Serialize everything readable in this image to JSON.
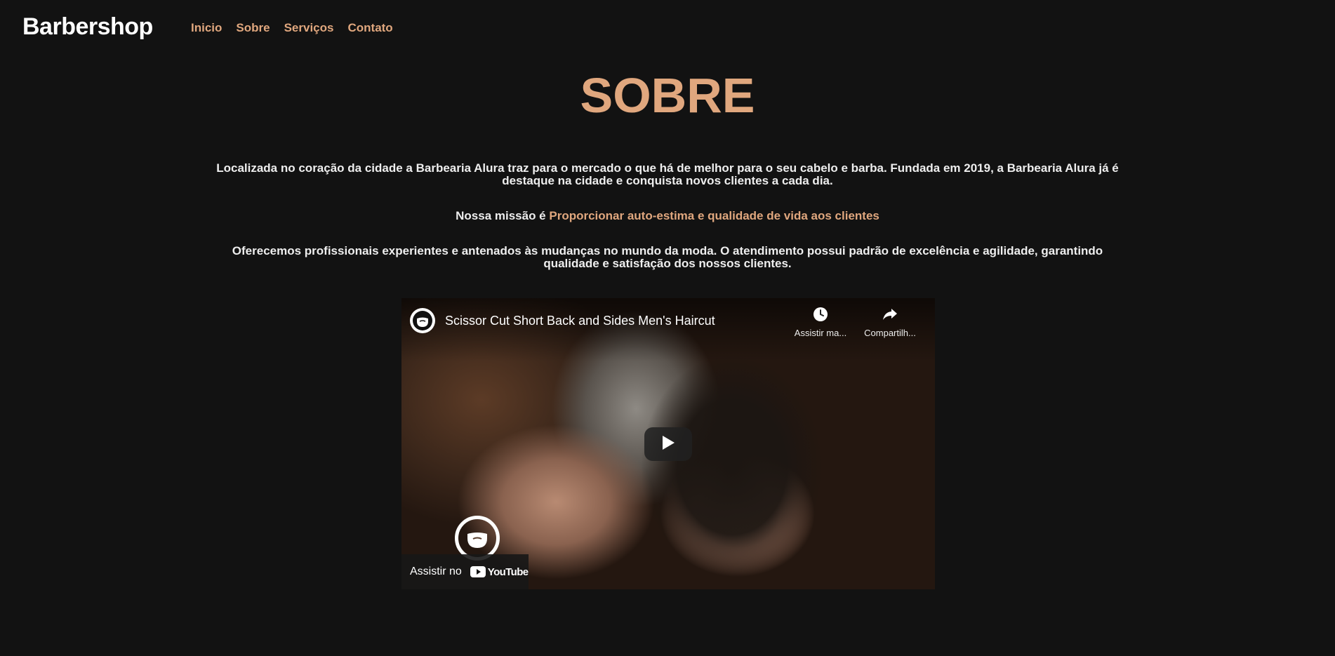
{
  "header": {
    "logo": "Barbershop",
    "nav": [
      {
        "label": "Inicio"
      },
      {
        "label": "Sobre"
      },
      {
        "label": "Serviços"
      },
      {
        "label": "Contato"
      }
    ]
  },
  "about": {
    "title": "SOBRE",
    "paragraph1": "Localizada no coração da cidade a Barbearia Alura traz para o mercado o que há de melhor para o seu cabelo e barba. Fundada em 2019, a Barbearia Alura já é destaque na cidade e conquista novos clientes a cada dia.",
    "mission_prefix": "Nossa missão é ",
    "mission_highlight": "Proporcionar auto-estima e qualidade de vida aos clientes",
    "paragraph3": "Oferecemos profissionais experientes e antenados às mudanças no mundo da moda. O atendimento possui padrão de excelência e agilidade, garantindo qualidade e satisfação dos nossos clientes."
  },
  "video": {
    "title": "Scissor Cut Short Back and Sides Men's Haircut",
    "watch_later": "Assistir ma...",
    "share": "Compartilh...",
    "watch_on": "Assistir no",
    "youtube": "YouTube"
  },
  "colors": {
    "background": "#121212",
    "accent": "#e0a77e",
    "text": "#eeeeee"
  },
  "icons": {
    "channel": "beard-logo-icon",
    "watch_later": "clock-icon",
    "share": "share-arrow-icon",
    "play": "play-icon",
    "youtube": "youtube-logo-icon"
  }
}
